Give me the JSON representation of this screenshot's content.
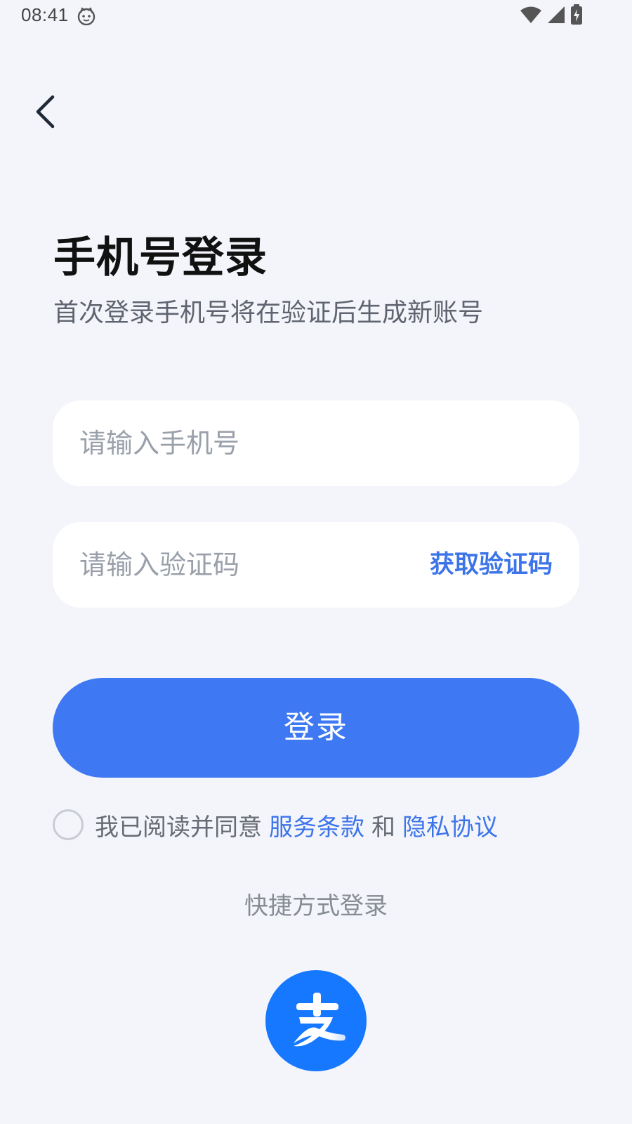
{
  "status_bar": {
    "time": "08:41",
    "app_icon": "cat-face-icon",
    "indicators": [
      "wifi-icon",
      "signal-icon",
      "battery-charging-icon"
    ]
  },
  "nav": {
    "back_icon": "chevron-left-icon"
  },
  "header": {
    "title": "手机号登录",
    "subtitle": "首次登录手机号将在验证后生成新账号"
  },
  "form": {
    "phone_placeholder": "请输入手机号",
    "phone_value": "",
    "code_placeholder": "请输入验证码",
    "code_value": "",
    "get_code_label": "获取验证码",
    "login_label": "登录"
  },
  "agreement": {
    "checked": false,
    "prefix": "我已阅读并同意",
    "terms_label": "服务条款",
    "connector": "和",
    "privacy_label": "隐私协议"
  },
  "quick_login": {
    "label": "快捷方式登录",
    "options": [
      "alipay-icon"
    ]
  },
  "colors": {
    "background": "#f3f5fa",
    "primary": "#3e78f3",
    "link": "#3d74e9",
    "alipay": "#1677ff"
  }
}
